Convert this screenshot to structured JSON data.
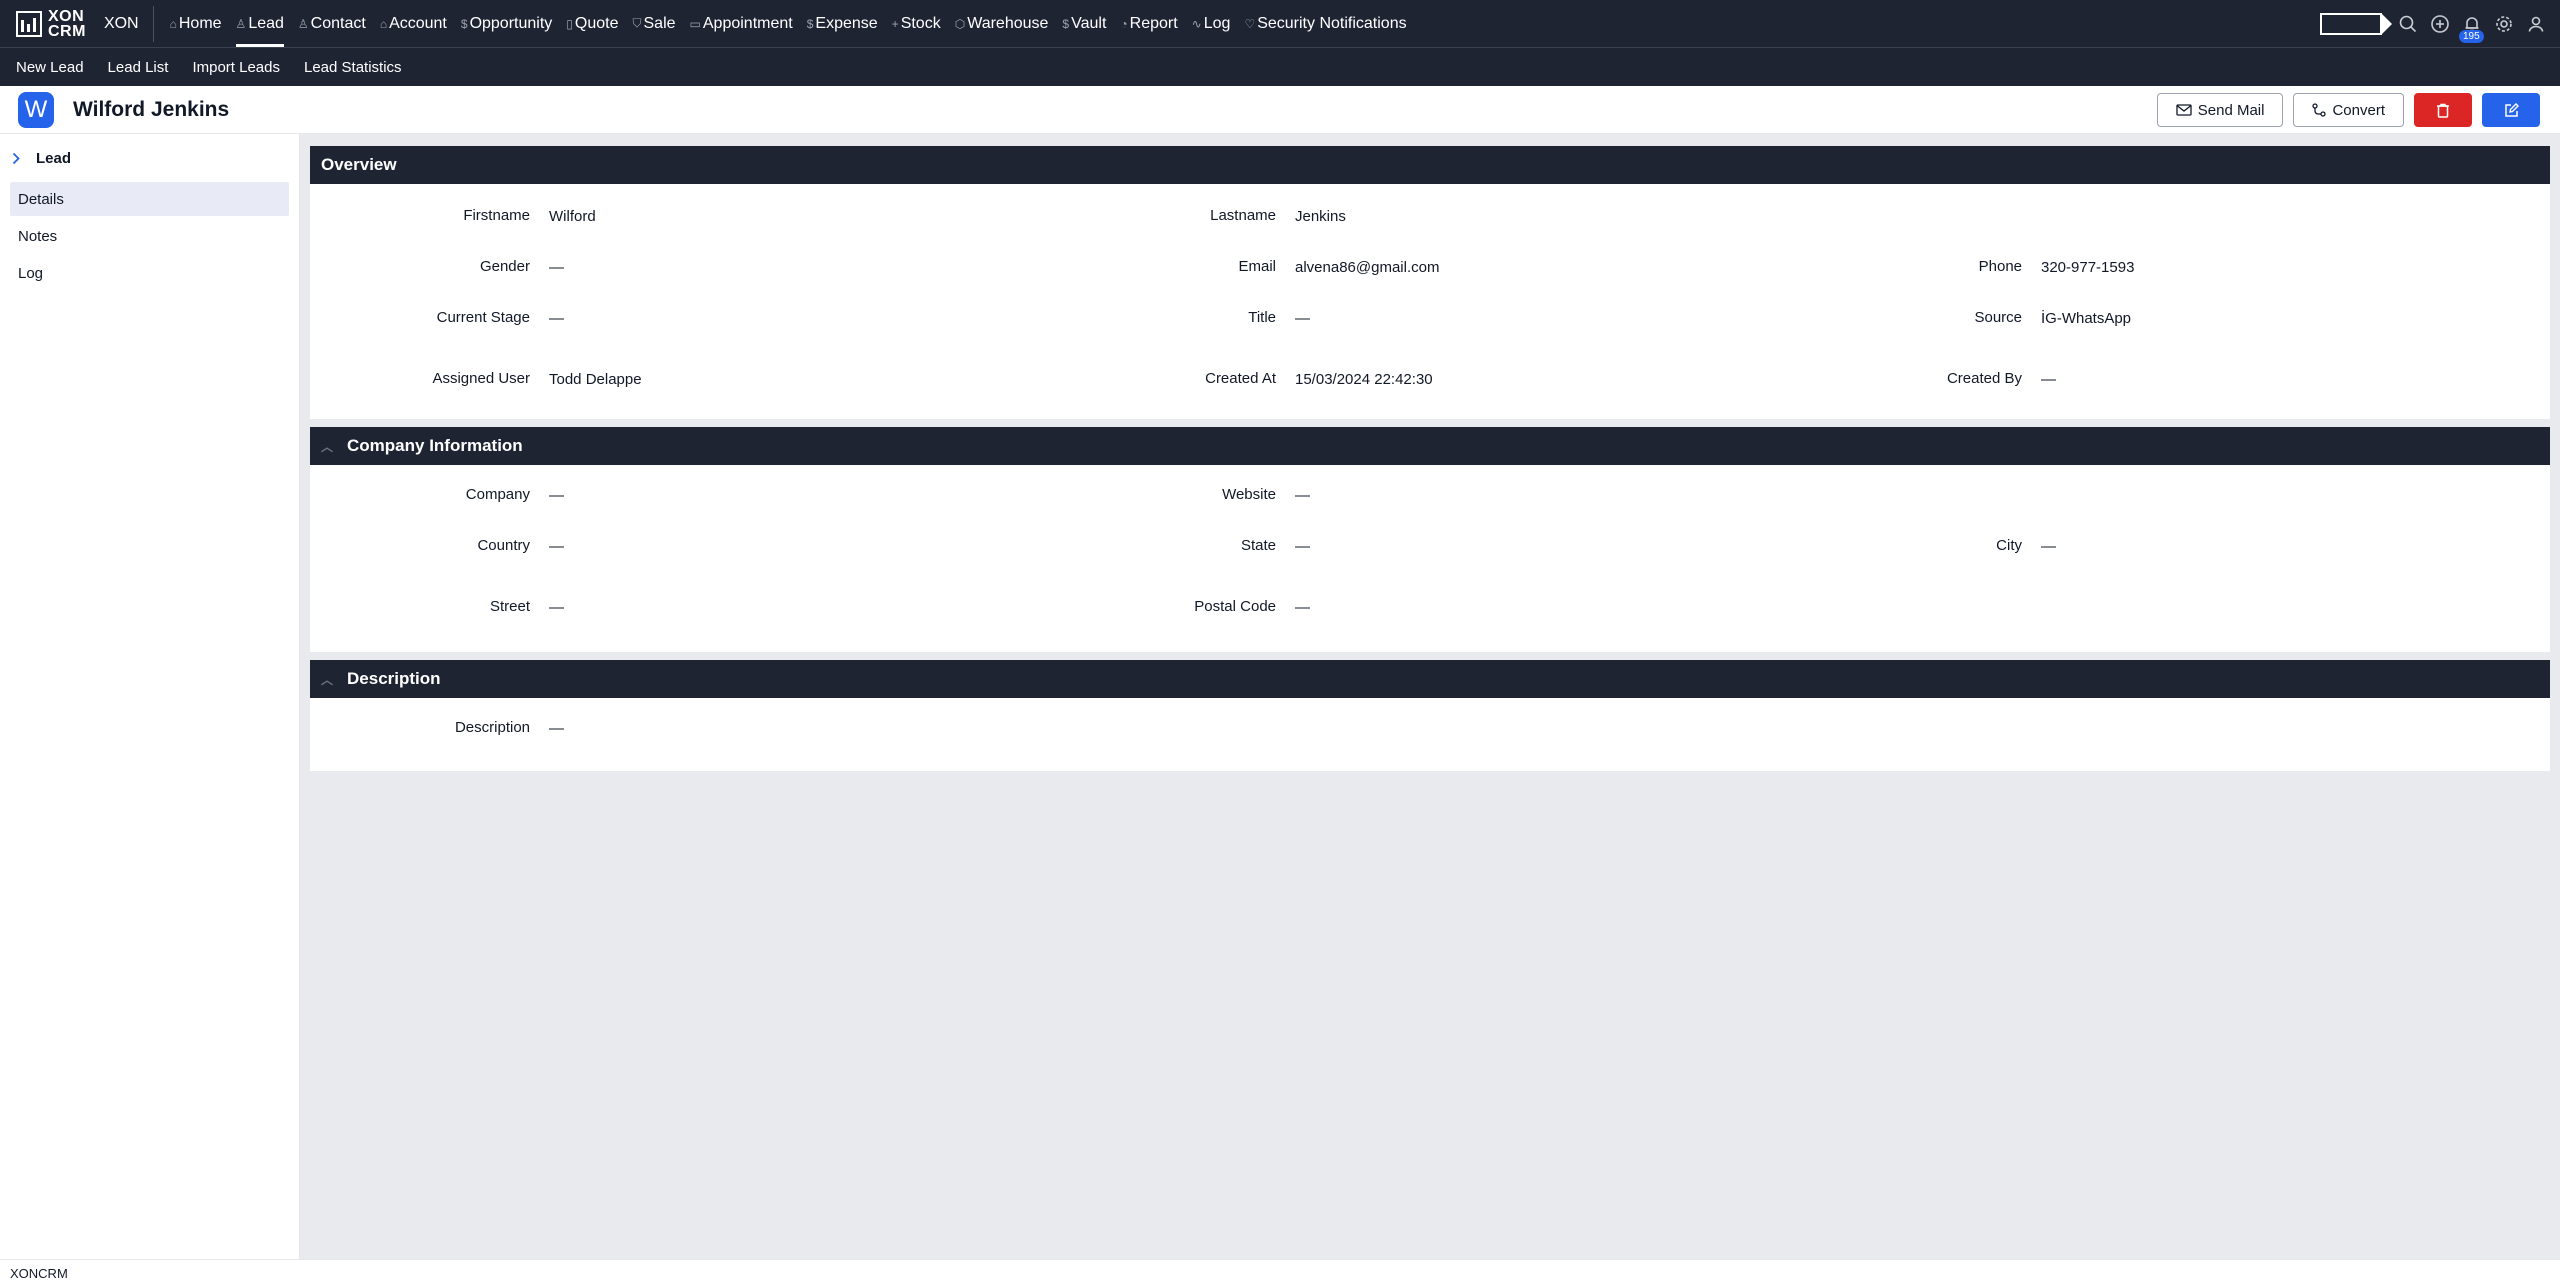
{
  "brand": {
    "logo_text_line1": "XON",
    "logo_text_line2": "CRM",
    "org": "XON"
  },
  "nav": {
    "items": [
      {
        "icon": "home-icon",
        "glyph": "⌂",
        "label": "Home"
      },
      {
        "icon": "user-icon",
        "glyph": "♙",
        "label": "Lead",
        "active": true
      },
      {
        "icon": "contact-icon",
        "glyph": "♙",
        "label": "Contact"
      },
      {
        "icon": "account-icon",
        "glyph": "⌂",
        "label": "Account"
      },
      {
        "icon": "dollar-icon",
        "glyph": "$",
        "label": "Opportunity"
      },
      {
        "icon": "document-icon",
        "glyph": "▯",
        "label": "Quote"
      },
      {
        "icon": "cart-icon",
        "glyph": "⛉",
        "label": "Sale"
      },
      {
        "icon": "calendar-icon",
        "glyph": "▭",
        "label": "Appointment"
      },
      {
        "icon": "dollar-icon",
        "glyph": "$",
        "label": "Expense"
      },
      {
        "icon": "plus-icon",
        "glyph": "+",
        "label": "Stock"
      },
      {
        "icon": "warehouse-icon",
        "glyph": "⬡",
        "label": "Warehouse"
      },
      {
        "icon": "dollar-icon",
        "glyph": "$",
        "label": "Vault"
      },
      {
        "icon": "report-icon",
        "glyph": "◔",
        "label": "Report"
      },
      {
        "icon": "log-icon",
        "glyph": "∿",
        "label": "Log"
      },
      {
        "icon": "shield-icon",
        "glyph": "♡",
        "label": "Security Notifications"
      }
    ],
    "notification_count": "195"
  },
  "subnav": [
    "New Lead",
    "Lead List",
    "Import Leads",
    "Lead Statistics"
  ],
  "header": {
    "avatar_letter": "W",
    "title": "Wilford Jenkins",
    "send_mail": "Send Mail",
    "convert": "Convert"
  },
  "sidebar": {
    "heading": "Lead",
    "items": [
      "Details",
      "Notes",
      "Log"
    ]
  },
  "overview": {
    "title": "Overview",
    "firstname_label": "Firstname",
    "firstname": "Wilford",
    "lastname_label": "Lastname",
    "lastname": "Jenkins",
    "gender_label": "Gender",
    "gender": "—",
    "email_label": "Email",
    "email": "alvena86@gmail.com",
    "phone_label": "Phone",
    "phone": "320-977-1593",
    "stage_label": "Current Stage",
    "stage": "—",
    "title_label": "Title",
    "title_val": "—",
    "source_label": "Source",
    "source": "İG-WhatsApp",
    "assigned_label": "Assigned User",
    "assigned": "Todd Delappe",
    "created_at_label": "Created At",
    "created_at": "15/03/2024 22:42:30",
    "created_by_label": "Created By",
    "created_by": "—"
  },
  "company": {
    "title": "Company Information",
    "company_label": "Company",
    "company": "—",
    "website_label": "Website",
    "website": "—",
    "country_label": "Country",
    "country": "—",
    "state_label": "State",
    "state": "—",
    "city_label": "City",
    "city": "—",
    "street_label": "Street",
    "street": "—",
    "postal_label": "Postal Code",
    "postal": "—"
  },
  "description": {
    "title": "Description",
    "label": "Description",
    "value": "—"
  },
  "footer": {
    "text": "XONCRM"
  }
}
